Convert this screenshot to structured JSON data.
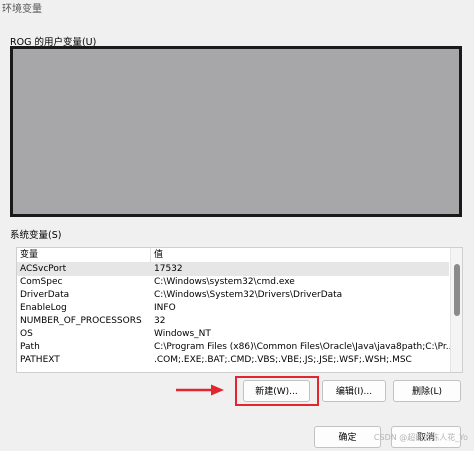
{
  "window": {
    "title": "环境变量"
  },
  "user_section": {
    "label": "ROG 的用户变量(U)"
  },
  "system_section": {
    "label": "系统变量(S)",
    "columns": {
      "variable": "变量",
      "value": "值"
    },
    "rows": [
      {
        "name": "ACSvcPort",
        "value": "17532"
      },
      {
        "name": "ComSpec",
        "value": "C:\\Windows\\system32\\cmd.exe"
      },
      {
        "name": "DriverData",
        "value": "C:\\Windows\\System32\\Drivers\\DriverData"
      },
      {
        "name": "EnableLog",
        "value": "INFO"
      },
      {
        "name": "NUMBER_OF_PROCESSORS",
        "value": "32"
      },
      {
        "name": "OS",
        "value": "Windows_NT"
      },
      {
        "name": "Path",
        "value": "C:\\Program Files (x86)\\Common Files\\Oracle\\Java\\java8path;C:\\Pr..."
      },
      {
        "name": "PATHEXT",
        "value": ".COM;.EXE;.BAT;.CMD;.VBS;.VBE;.JS;.JSE;.WSF;.WSH;.MSC"
      }
    ],
    "selected_row": 0
  },
  "buttons": {
    "new": "新建(W)...",
    "edit": "编辑(I)...",
    "delete": "删除(L)",
    "ok": "确定",
    "cancel": "取消"
  },
  "annotation": {
    "color": "#e2262f"
  },
  "watermark": "CSDN @超能的陈人花_Yo"
}
